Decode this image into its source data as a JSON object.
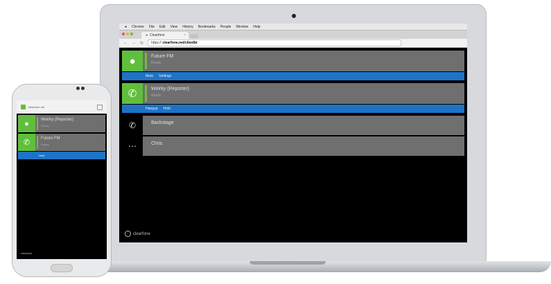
{
  "laptop": {
    "menubar": [
      "Chrome",
      "File",
      "Edit",
      "View",
      "History",
      "Bookmarks",
      "People",
      "Window",
      "Help"
    ],
    "tab_title": "Clearfone",
    "url_prefix": "https://",
    "url_text": "clearfone.net/clientbr",
    "channels": [
      {
        "title": "Future FM",
        "sub": "Ready",
        "icon": "microphone-icon",
        "action_labels": [
          "Mute",
          "Settings"
        ]
      },
      {
        "title": "Weirky (Reporter)",
        "sub": "Ready",
        "icon": "phone-icon",
        "action_labels": [
          "Hangup",
          "Hold"
        ]
      }
    ],
    "lines": [
      {
        "title": "Backstage",
        "icon": "phone-icon"
      },
      {
        "title": "Chris",
        "icon": "more-icon"
      }
    ],
    "brand": "clearfone"
  },
  "phone": {
    "status": "",
    "url": "clearfone.net",
    "channels": [
      {
        "title": "Weirky (Reporter)",
        "sub": "Ready",
        "icon": "microphone-icon"
      },
      {
        "title": "Future FM",
        "sub": "Ready",
        "icon": "phone-icon"
      }
    ],
    "action_label": "Hold",
    "brand": "clearfone"
  },
  "colors": {
    "accent_green": "#5fbf3c",
    "action_blue": "#1f73c6",
    "row_grey": "#6f6f6f"
  }
}
